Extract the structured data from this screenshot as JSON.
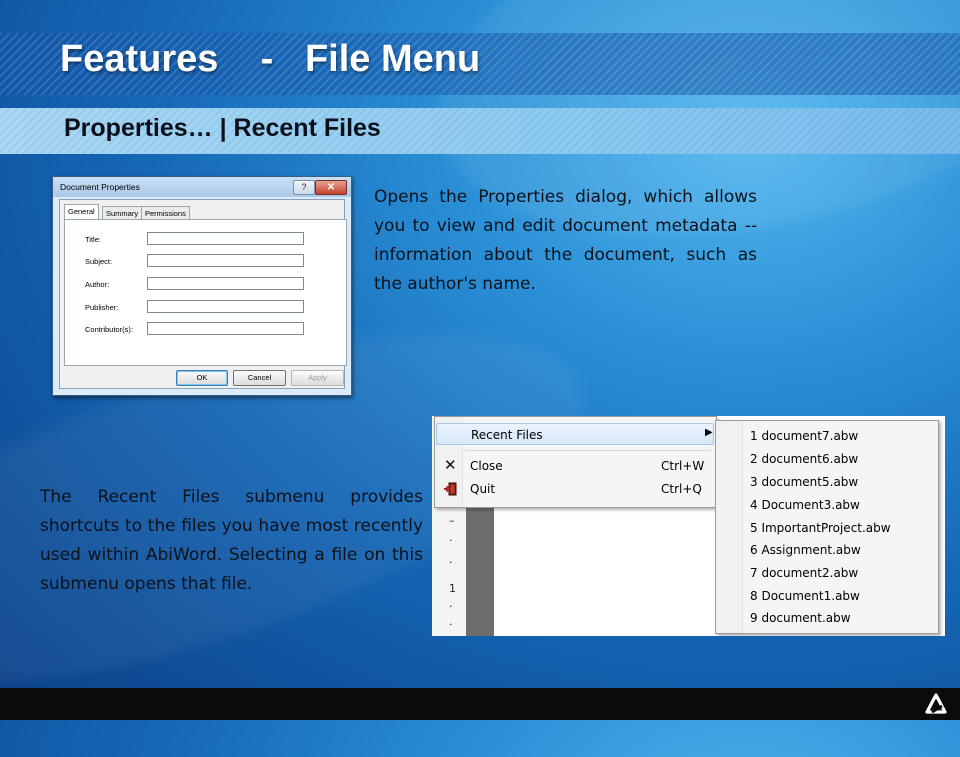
{
  "slide": {
    "title": "Features    -   File Menu",
    "subtitle": "Properties… | Recent Files",
    "properties_text": "Opens the Properties dialog, which allows you to view and edit document metadata -- information about the document, such as the author's name.",
    "recent_text": "The Recent Files submenu provides shortcuts to the files you have most recently used within AbiWord. Selecting a file on this submenu opens that file."
  },
  "properties_dialog": {
    "title": "Document Properties",
    "help_glyph": "?",
    "close_glyph": "✕",
    "tabs": [
      "General",
      "Summary",
      "Permissions"
    ],
    "fields": [
      {
        "label": "Title:",
        "value": ""
      },
      {
        "label": "Subject:",
        "value": ""
      },
      {
        "label": "Author:",
        "value": ""
      },
      {
        "label": "Publisher:",
        "value": ""
      },
      {
        "label": "Contributor(s):",
        "value": ""
      }
    ],
    "buttons": {
      "ok": "OK",
      "cancel": "Cancel",
      "apply": "Apply"
    }
  },
  "file_menu": {
    "recent_files_label": "Recent Files",
    "submenu_arrow": "▶",
    "close_label": "Close",
    "close_shortcut": "Ctrl+W",
    "quit_label": "Quit",
    "quit_shortcut": "Ctrl+Q",
    "recent_files": [
      "1 document7.abw",
      "2 document6.abw",
      "3 document5.abw",
      "4 Document3.abw",
      "5 ImportantProject.abw",
      "6 Assignment.abw",
      "7 document2.abw",
      "8 Document1.abw",
      "9 document.abw"
    ],
    "ruler_marks": [
      "–",
      "·",
      "·",
      "1",
      "·",
      "·"
    ]
  },
  "colors": {
    "background_accent": "#1f7fcf",
    "subtitle_band": "#8ccaf2",
    "dialog_close": "#c5442e",
    "footer": "#0b0b0b"
  },
  "icons": {
    "close_menu_icon": "close-icon",
    "quit_menu_icon": "exit-icon",
    "footer_logo": "abiword-logo-icon"
  }
}
